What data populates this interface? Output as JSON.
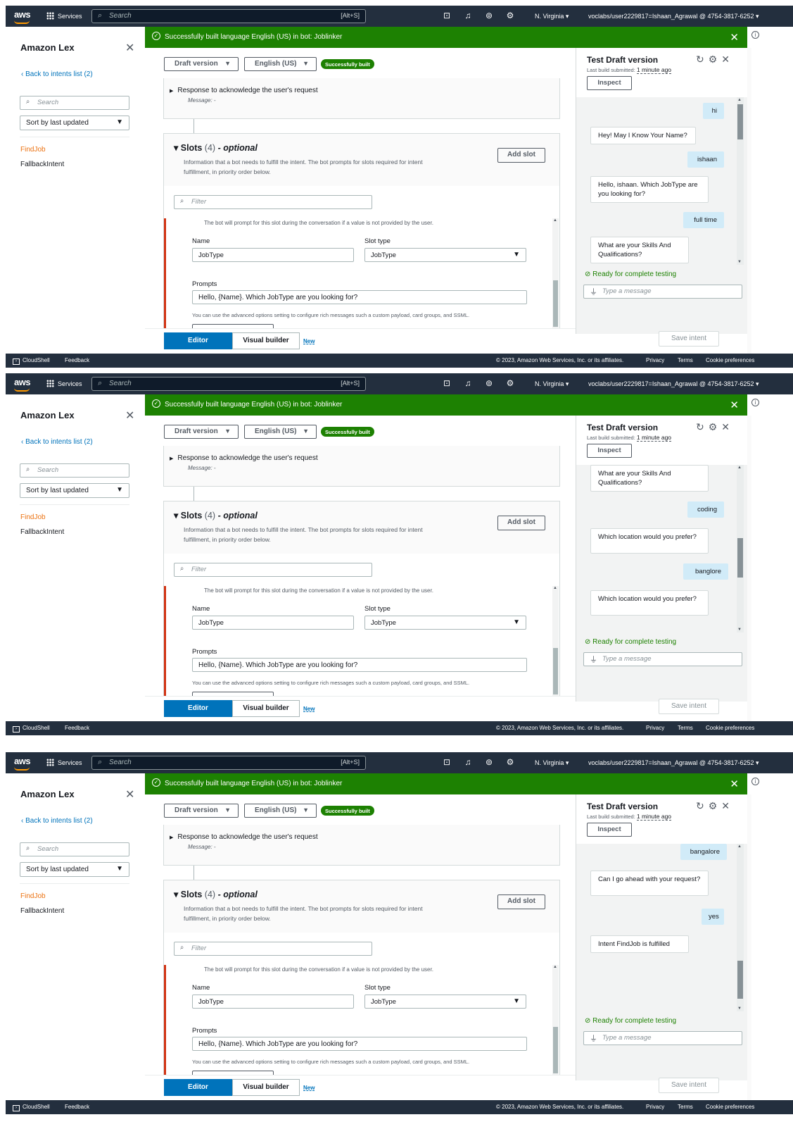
{
  "topnav": {
    "logo": "aws",
    "services": "Services",
    "search_placeholder": "Search",
    "shortcut": "[Alt+S]",
    "region": "N. Virginia ▾",
    "account": "voclabs/user2229817=Ishaan_Agrawal @ 4754-3817-6252 ▾"
  },
  "sidebar": {
    "title": "Amazon Lex",
    "back": "Back to intents list (2)",
    "search_placeholder": "Search",
    "sort": "Sort by last updated",
    "intents": [
      "FindJob",
      "FallbackIntent"
    ]
  },
  "flash": {
    "message": "Successfully built language English (US) in bot: Joblinker"
  },
  "toolbar": {
    "draft": "Draft version",
    "language": "English (US)",
    "badge": "Successfully built"
  },
  "response": {
    "title": "Response to acknowledge the user's request",
    "message": "Message: -"
  },
  "slots": {
    "title": "Slots",
    "count": "(4)",
    "optional": "- optional",
    "description": "Information that a bot needs to fulfill the intent. The bot prompts for slots required for intent fulfillment, in priority order below.",
    "add_slot": "Add slot",
    "filter_placeholder": "Filter",
    "hint": "The bot will prompt for this slot during the conversation if a value is not provided by the user.",
    "name_label": "Name",
    "name_value": "JobType",
    "slot_type_label": "Slot type",
    "slot_type_value": "JobType",
    "prompts_label": "Prompts",
    "prompt_value": "Hello, {Name}. Which JobType are you looking for?",
    "advanced": "You can use the advanced options setting to configure rich messages such a custom payload, card groups, and SSML."
  },
  "bottom": {
    "editor": "Editor",
    "visual": "Visual builder",
    "new": "New",
    "save": "Save intent"
  },
  "test": {
    "title": "Test Draft version",
    "sub_prefix": "Last build submitted:",
    "sub_time": "1 minute ago",
    "inspect": "Inspect",
    "ready": "Ready for complete testing",
    "placeholder": "Type a message"
  },
  "chats": [
    {
      "messages": [
        {
          "from": "user",
          "text": "hi"
        },
        {
          "from": "bot",
          "text": "Hey! May I Know Your Name?"
        },
        {
          "from": "user",
          "text": "ishaan"
        },
        {
          "from": "bot",
          "text": "Hello, ishaan. Which JobType are you looking for?"
        },
        {
          "from": "user",
          "text": "full time"
        },
        {
          "from": "bot",
          "text": "What are your Skills And Qualifications?"
        }
      ]
    },
    {
      "messages": [
        {
          "from": "bot",
          "text": "What are your Skills And Qualifications?"
        },
        {
          "from": "user",
          "text": "coding"
        },
        {
          "from": "bot",
          "text": "Which location would you prefer?"
        },
        {
          "from": "user",
          "text": "banglore"
        },
        {
          "from": "bot",
          "text": "Which location would you prefer?"
        }
      ]
    },
    {
      "messages": [
        {
          "from": "user",
          "text": "bangalore"
        },
        {
          "from": "bot",
          "text": "Can I go ahead with your request?"
        },
        {
          "from": "user",
          "text": "yes"
        },
        {
          "from": "bot",
          "text": "Intent FindJob is fulfilled"
        }
      ]
    }
  ],
  "footer": {
    "cloudshell": "CloudShell",
    "feedback": "Feedback",
    "copyright": "© 2023, Amazon Web Services, Inc. or its affiliates.",
    "privacy": "Privacy",
    "terms": "Terms",
    "cookie": "Cookie preferences"
  },
  "colors": {
    "nav": "#232f3e",
    "success": "#1d8102",
    "accent": "#0073bb",
    "orange": "#ec7211",
    "error": "#d13212"
  }
}
